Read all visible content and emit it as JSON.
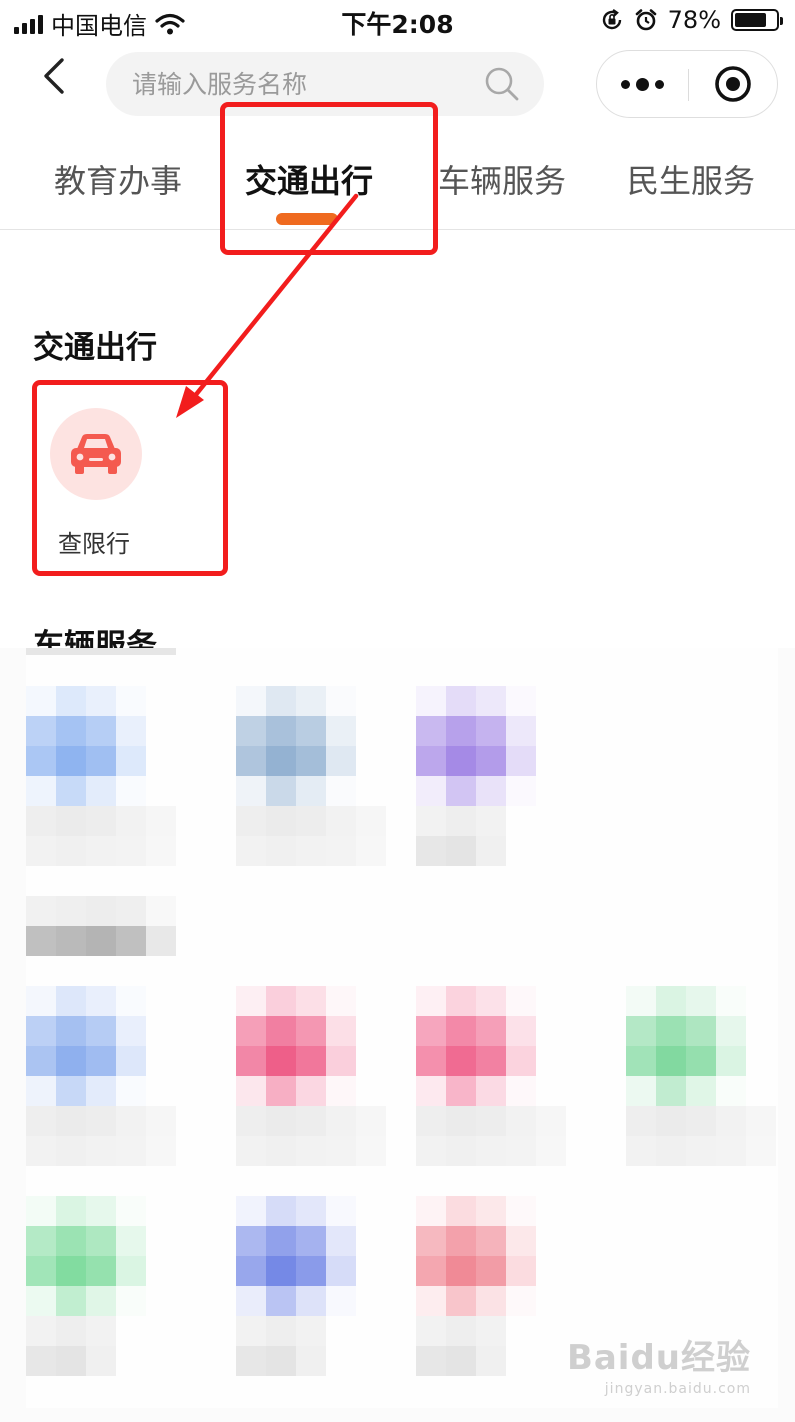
{
  "status_bar": {
    "carrier": "中国电信",
    "time": "下午2:08",
    "battery_text": "78%",
    "battery_level": 0.78,
    "icons": [
      "signal-icon",
      "wifi-icon",
      "rotation-lock-icon",
      "alarm-icon",
      "battery-icon"
    ]
  },
  "nav": {
    "back_icon": "chevron-left-icon",
    "search_placeholder": "请输入服务名称",
    "search_icon": "search-icon",
    "more_icon": "more-dots-icon",
    "close_icon": "target-close-icon"
  },
  "tabs": [
    {
      "label": "教育办事",
      "active": false
    },
    {
      "label": "交通出行",
      "active": true
    },
    {
      "label": "车辆服务",
      "active": false
    },
    {
      "label": "民生服务",
      "active": false
    }
  ],
  "accent_color": "#ef6a1f",
  "annotation_color": "#f21d1d",
  "sections": {
    "traffic": {
      "title": "交通出行",
      "items": [
        {
          "label": "查限行",
          "icon": "car-icon",
          "icon_bg": "#fde3e1",
          "icon_color": "#f45a4f"
        }
      ]
    },
    "vehicle": {
      "title": "车辆服务"
    }
  },
  "watermark": {
    "logo": "Baidu经验",
    "url": "jingyan.baidu.com"
  }
}
